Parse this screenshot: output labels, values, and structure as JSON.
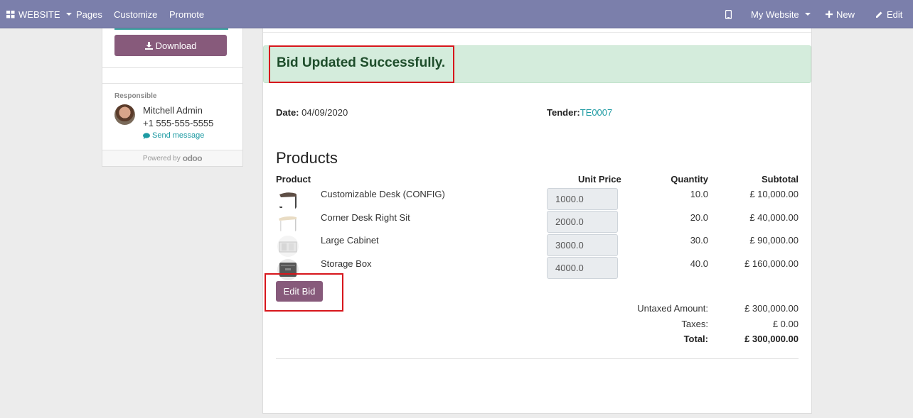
{
  "topbar": {
    "website_label": "WEBSITE",
    "pages": "Pages",
    "customize": "Customize",
    "promote": "Promote",
    "my_website": "My Website",
    "new": "New",
    "edit": "Edit"
  },
  "sidebar": {
    "download_label": "Download",
    "responsible_label": "Responsible",
    "responsible_name": "Mitchell Admin",
    "responsible_phone": "+1 555-555-5555",
    "send_message": "Send message",
    "powered_by": "Powered by",
    "powered_logo": "odoo"
  },
  "alert": {
    "message": "Bid Updated Successfully."
  },
  "meta": {
    "date_label": "Date:",
    "date_value": "04/09/2020",
    "tender_label": "Tender:",
    "tender_value": "TE0007"
  },
  "products": {
    "heading": "Products",
    "columns": {
      "product": "Product",
      "unit_price": "Unit Price",
      "quantity": "Quantity",
      "subtotal": "Subtotal"
    },
    "rows": [
      {
        "name": "Customizable Desk (CONFIG)",
        "unit_price": "1000.0",
        "quantity": "10.0",
        "subtotal": "£ 10,000.00",
        "image": "desk-image"
      },
      {
        "name": "Corner Desk Right Sit",
        "unit_price": "2000.0",
        "quantity": "20.0",
        "subtotal": "£ 40,000.00",
        "image": "corner-desk-image"
      },
      {
        "name": "Large Cabinet",
        "unit_price": "3000.0",
        "quantity": "30.0",
        "subtotal": "£ 90,000.00",
        "image": "cabinet-image"
      },
      {
        "name": "Storage Box",
        "unit_price": "4000.0",
        "quantity": "40.0",
        "subtotal": "£ 160,000.00",
        "image": "storage-box-image"
      }
    ],
    "edit_bid_label": "Edit Bid"
  },
  "totals": {
    "untaxed_label": "Untaxed Amount:",
    "untaxed_value": "£ 300,000.00",
    "taxes_label": "Taxes:",
    "taxes_value": "£ 0.00",
    "total_label": "Total:",
    "total_value": "£ 300,000.00"
  },
  "colors": {
    "topbar": "#7b7fab",
    "primary_button": "#875a7b",
    "link": "#1e9ba3",
    "success_bg": "#d4ecdc",
    "highlight": "#d7161c"
  }
}
